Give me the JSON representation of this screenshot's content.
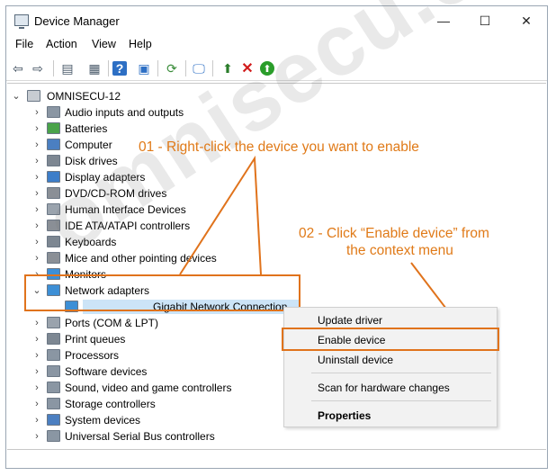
{
  "window": {
    "title": "Device Manager",
    "minimize": "—",
    "maximize": "☐",
    "close": "✕"
  },
  "menu": [
    "File",
    "Action",
    "View",
    "Help"
  ],
  "toolbar": {
    "buttons": [
      {
        "name": "back-icon",
        "glyph": "⇦"
      },
      {
        "name": "forward-icon",
        "glyph": "⇨"
      },
      {
        "name": "properties-icon",
        "glyph": "▤"
      },
      {
        "name": "view-icon",
        "glyph": "▦"
      },
      {
        "name": "help-icon",
        "glyph": "?"
      },
      {
        "name": "show-hidden-icon",
        "glyph": "▣"
      },
      {
        "name": "update-driver-icon",
        "glyph": "⟳"
      },
      {
        "name": "scan-hardware-icon",
        "glyph": "🖵"
      },
      {
        "name": "add-legacy-icon",
        "glyph": "⬆"
      },
      {
        "name": "uninstall-icon",
        "glyph": "✕"
      },
      {
        "name": "enable-icon",
        "glyph": "⬆"
      }
    ]
  },
  "tree": {
    "root": "OMNISECU-12",
    "categories": [
      "Audio inputs and outputs",
      "Batteries",
      "Computer",
      "Disk drives",
      "Display adapters",
      "DVD/CD-ROM drives",
      "Human Interface Devices",
      "IDE ATA/ATAPI controllers",
      "Keyboards",
      "Mice and other pointing devices",
      "Monitors",
      "Network adapters",
      "Ports (COM & LPT)",
      "Print queues",
      "Processors",
      "Software devices",
      "Sound, video and game controllers",
      "Storage controllers",
      "System devices",
      "Universal Serial Bus controllers"
    ],
    "expanded_device": "Gigabit Network Connection"
  },
  "context_menu": {
    "update": "Update driver",
    "enable": "Enable device",
    "uninstall": "Uninstall device",
    "scan": "Scan for hardware changes",
    "properties": "Properties"
  },
  "annotations": {
    "step1": "01 - Right-click the device you want to enable",
    "step2_line1": "02 - Click “Enable device” from",
    "step2_line2": "the context menu",
    "color": "#e0731c"
  },
  "watermark": "omnisecu.com"
}
